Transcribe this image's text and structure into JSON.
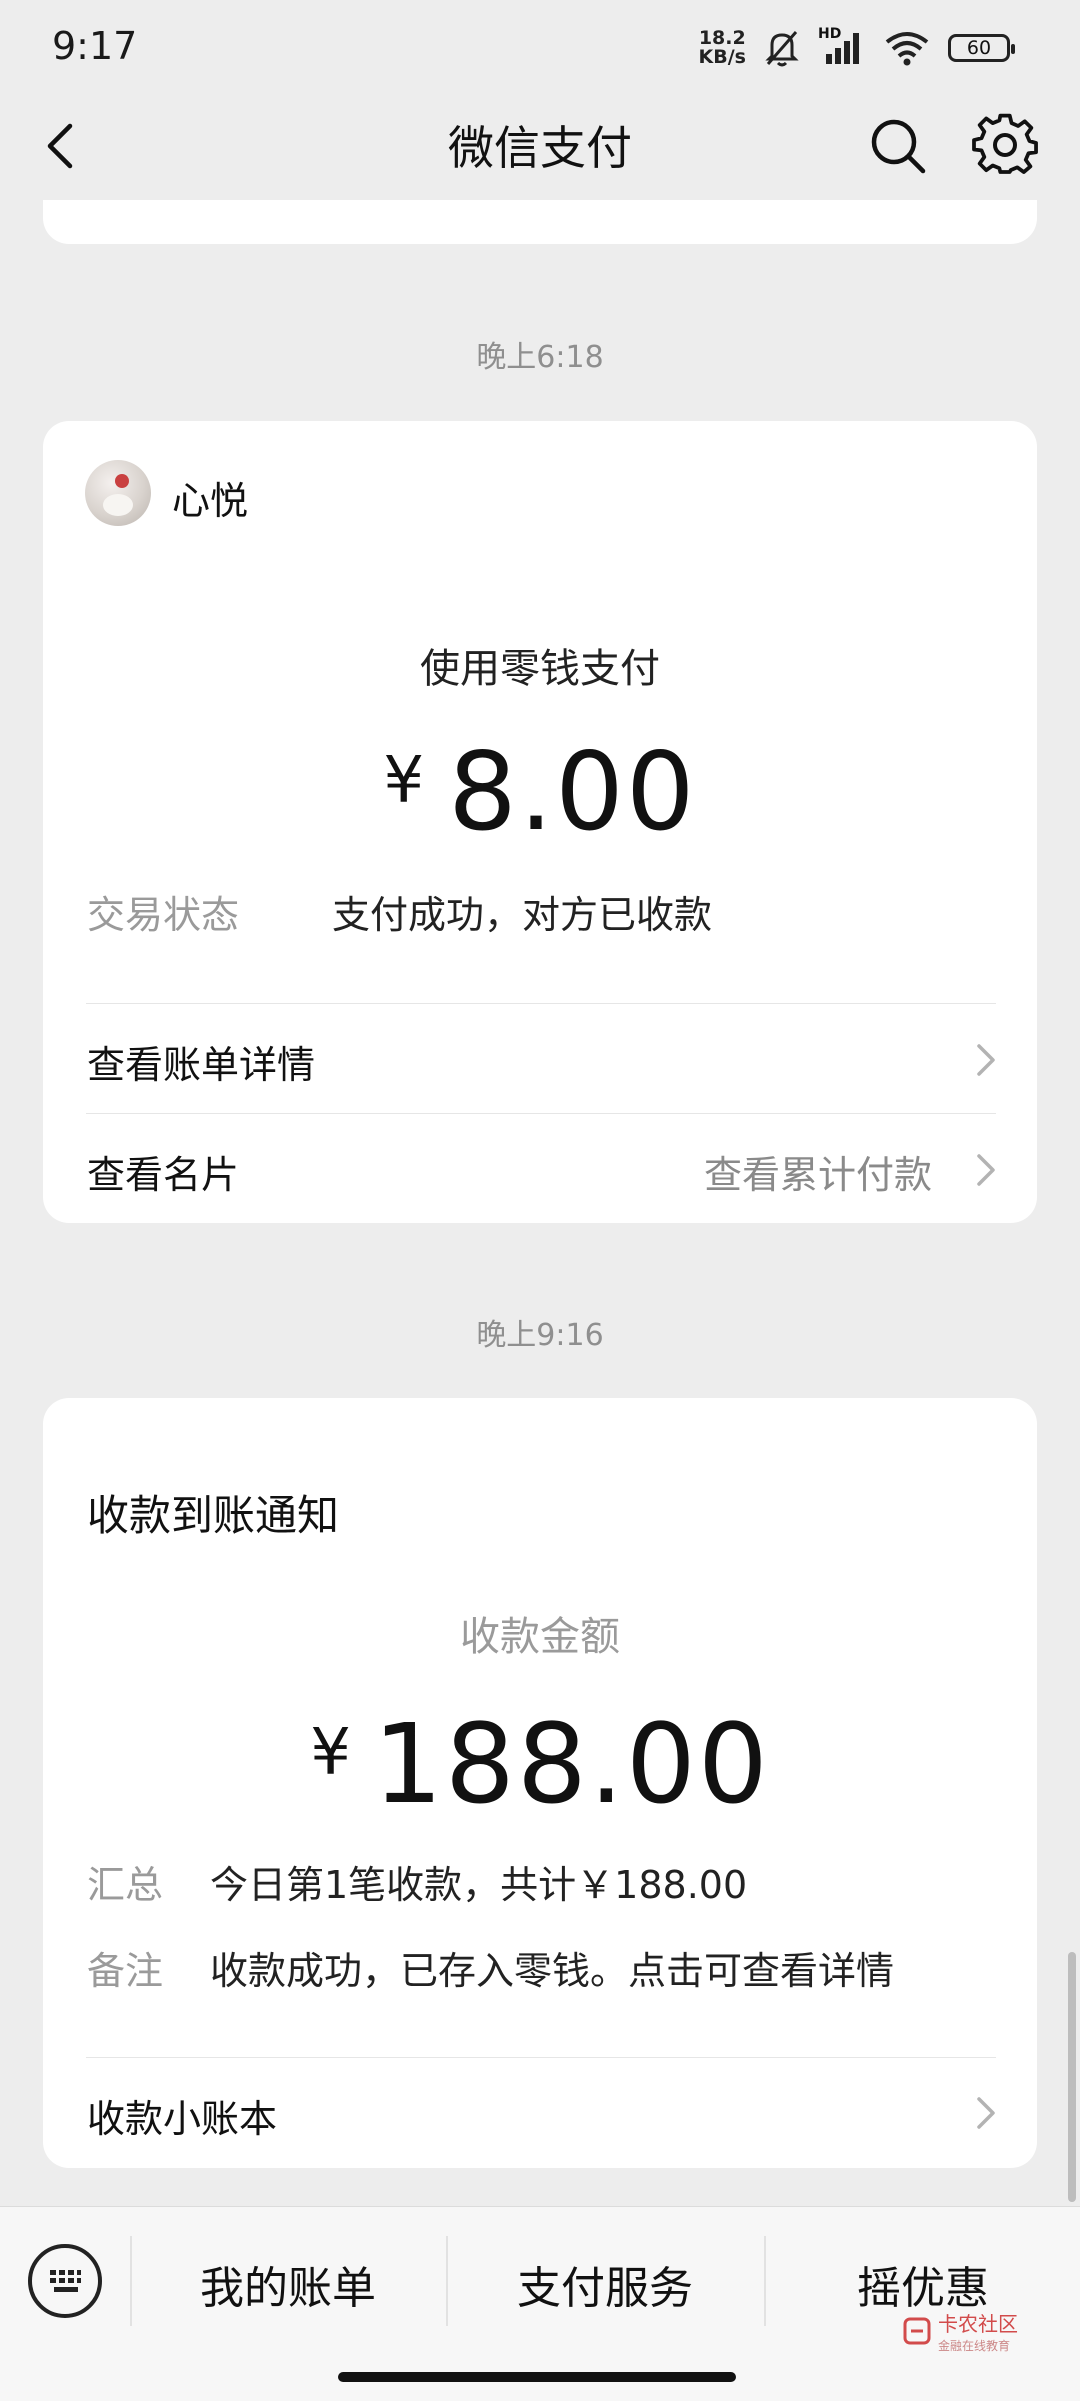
{
  "status_bar": {
    "time": "9:17",
    "net_speed_value": "18.2",
    "net_speed_unit": "KB/s",
    "network": "HD",
    "battery": "60"
  },
  "nav": {
    "title": "微信支付",
    "icons": [
      "back-icon",
      "search-icon",
      "gear-icon"
    ]
  },
  "messages": [
    {
      "time": "晚上6:18",
      "merchant": "心悦",
      "pay_method": "使用零钱支付",
      "currency": "¥",
      "amount": "8.00",
      "status_label": "交易状态",
      "status_value": "支付成功，对方已收款",
      "link_bill": "查看账单详情",
      "link_card": "查看名片",
      "link_card_right": "查看累计付款"
    },
    {
      "time": "晚上9:16",
      "title": "收款到账通知",
      "amount_label": "收款金额",
      "currency": "¥",
      "amount": "188.00",
      "summary_label": "汇总",
      "summary_value": "今日第1笔收款，共计￥188.00",
      "remark_label": "备注",
      "remark_value": "收款成功，已存入零钱。点击可查看详情",
      "link_ledger": "收款小账本"
    }
  ],
  "bottom_bar": {
    "tabs": [
      "我的账单",
      "支付服务",
      "摇优惠"
    ]
  },
  "watermark": {
    "name": "卡农社区",
    "sub": "金融在线教育"
  },
  "colors": {
    "background": "#ededed",
    "card": "#ffffff",
    "muted_text": "#9a9a9a"
  }
}
